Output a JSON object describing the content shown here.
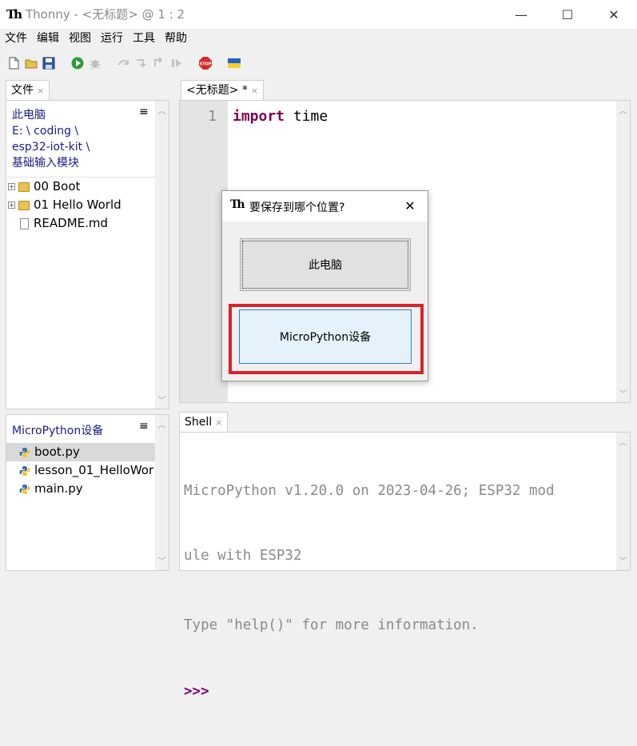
{
  "window": {
    "title": "Thonny  -  <无标题>  @  1 : 2",
    "logo_text": "Th",
    "minimize": "—",
    "maximize": "☐",
    "close": "✕"
  },
  "menu": [
    "文件",
    "编辑",
    "视图",
    "运行",
    "工具",
    "帮助"
  ],
  "toolbar_icons": [
    "new-file-icon",
    "open-file-icon",
    "save-icon",
    "run-icon",
    "debug-icon",
    "step-over-icon",
    "step-into-icon",
    "step-out-icon",
    "resume-icon",
    "stop-icon",
    "ukraine-flag-icon"
  ],
  "files_panel": {
    "tab_label": "文件",
    "tab_close": "×",
    "menu_glyph": "≡",
    "path": [
      "此电脑",
      "E: \\ coding \\",
      "esp32-iot-kit \\",
      "基础输入模块"
    ],
    "items": [
      {
        "type": "folder",
        "name": "00 Boot",
        "expand": "+"
      },
      {
        "type": "folder",
        "name": "01 Hello World",
        "expand": "+"
      },
      {
        "type": "file",
        "name": "README.md"
      }
    ]
  },
  "device_panel": {
    "title": "MicroPython设备",
    "menu_glyph": "≡",
    "items": [
      {
        "name": "boot.py",
        "selected": true
      },
      {
        "name": "lesson_01_HelloWor",
        "selected": false
      },
      {
        "name": "main.py",
        "selected": false
      }
    ]
  },
  "editor": {
    "tab_label": "<无标题> *",
    "tab_close": "×",
    "line_number": "1",
    "code_keyword": "import",
    "code_rest": " time"
  },
  "shell": {
    "tab_label": "Shell",
    "tab_close": "×",
    "line1": "MicroPython v1.20.0 on 2023-04-26; ESP32 mod",
    "line2": "ule with ESP32",
    "line3": "Type \"help()\" for more information.",
    "prompt": ">>>"
  },
  "dialog": {
    "title": "要保存到哪个位置?",
    "close": "✕",
    "option_computer": "此电脑",
    "option_device": "MicroPython设备",
    "highlight_color": "#d9232a"
  },
  "colors": {
    "keyword": "#7f0055",
    "prompt": "#800080",
    "shell_text": "#8a8a8a",
    "link_blue": "#1a1a8c"
  }
}
